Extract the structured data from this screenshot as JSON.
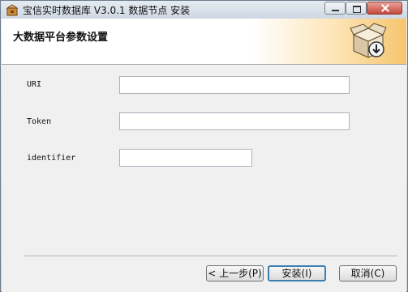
{
  "window": {
    "title": "宝信实时数据库 V3.0.1 数据节点 安装"
  },
  "header": {
    "title": "大数据平台参数设置",
    "icon": "install-box-icon"
  },
  "form": {
    "fields": [
      {
        "label": "URI",
        "value": ""
      },
      {
        "label": "Token",
        "value": ""
      },
      {
        "label": "identifier",
        "value": ""
      }
    ]
  },
  "buttons": {
    "prev": "< 上一步(P)",
    "install": "安装(I)",
    "cancel": "取消(C)"
  },
  "colors": {
    "header_gradient_end": "#f5c56e",
    "default_button_border": "#3c7fb1"
  }
}
